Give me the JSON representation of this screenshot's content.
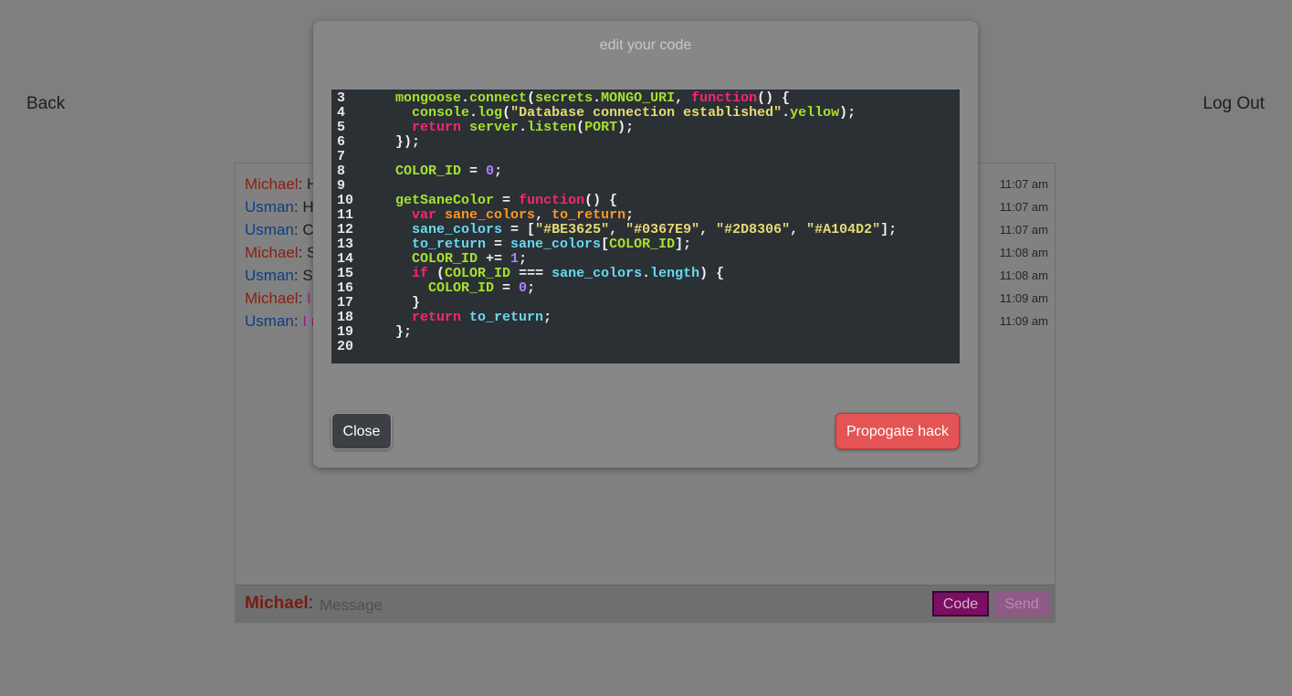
{
  "nav": {
    "back_label": "Back",
    "logout_label": "Log Out"
  },
  "colors": {
    "michael": "#8b1e12",
    "usman": "#0b3f86",
    "magenta_text": "#9a1e87"
  },
  "messages": [
    {
      "sender": "Michael",
      "text": "He",
      "time": "11:07 am",
      "magenta": false
    },
    {
      "sender": "Usman",
      "text": "Hey",
      "time": "11:07 am",
      "magenta": false
    },
    {
      "sender": "Usman",
      "text": "Can",
      "time": "11:07 am",
      "magenta": false
    },
    {
      "sender": "Michael",
      "text": "Su",
      "time": "11:08 am",
      "magenta": false
    },
    {
      "sender": "Usman",
      "text": "Sure",
      "time": "11:08 am",
      "magenta": false
    },
    {
      "sender": "Michael",
      "text": "I m",
      "time": "11:09 am",
      "magenta": true
    },
    {
      "sender": "Usman",
      "text": "I mo",
      "time": "11:09 am",
      "magenta": true
    }
  ],
  "composer": {
    "user": "Michael",
    "placeholder": "Message",
    "code_label": "Code",
    "send_label": "Send"
  },
  "modal": {
    "title": "edit your code",
    "close_label": "Close",
    "propagate_label": "Propogate hack",
    "code_lines": [
      {
        "n": "3",
        "tokens": [
          [
            "  ",
            "w"
          ],
          [
            "mongoose",
            "g"
          ],
          [
            ".",
            "w"
          ],
          [
            "connect",
            "g"
          ],
          [
            "(",
            "w"
          ],
          [
            "secrets",
            "g"
          ],
          [
            ".",
            "w"
          ],
          [
            "MONGO_URI",
            "g"
          ],
          [
            ", ",
            "w"
          ],
          [
            "function",
            "p"
          ],
          [
            "() {",
            "w"
          ]
        ]
      },
      {
        "n": "4",
        "tokens": [
          [
            "    ",
            "w"
          ],
          [
            "console",
            "g"
          ],
          [
            ".",
            "w"
          ],
          [
            "log",
            "g"
          ],
          [
            "(",
            "w"
          ],
          [
            "\"Database connection established\"",
            "y"
          ],
          [
            ".",
            "w"
          ],
          [
            "yellow",
            "g"
          ],
          [
            ");",
            "w"
          ]
        ]
      },
      {
        "n": "5",
        "tokens": [
          [
            "    ",
            "w"
          ],
          [
            "return",
            "p"
          ],
          [
            " ",
            "w"
          ],
          [
            "server",
            "g"
          ],
          [
            ".",
            "w"
          ],
          [
            "listen",
            "g"
          ],
          [
            "(",
            "w"
          ],
          [
            "PORT",
            "g"
          ],
          [
            ");",
            "w"
          ]
        ]
      },
      {
        "n": "6",
        "tokens": [
          [
            "  });",
            "w"
          ]
        ]
      },
      {
        "n": "7",
        "tokens": []
      },
      {
        "n": "8",
        "tokens": [
          [
            "  ",
            "w"
          ],
          [
            "COLOR_ID",
            "g"
          ],
          [
            " = ",
            "w"
          ],
          [
            "0",
            "v"
          ],
          [
            ";",
            "w"
          ]
        ]
      },
      {
        "n": "9",
        "tokens": []
      },
      {
        "n": "10",
        "tokens": [
          [
            "  ",
            "w"
          ],
          [
            "getSaneColor",
            "g"
          ],
          [
            " = ",
            "w"
          ],
          [
            "function",
            "p"
          ],
          [
            "() {",
            "w"
          ]
        ]
      },
      {
        "n": "11",
        "tokens": [
          [
            "    ",
            "w"
          ],
          [
            "var",
            "p"
          ],
          [
            " ",
            "w"
          ],
          [
            "sane_colors",
            "o"
          ],
          [
            ", ",
            "w"
          ],
          [
            "to_return",
            "o"
          ],
          [
            ";",
            "w"
          ]
        ]
      },
      {
        "n": "12",
        "tokens": [
          [
            "    ",
            "w"
          ],
          [
            "sane_colors",
            "c"
          ],
          [
            " = [",
            "w"
          ],
          [
            "\"#BE3625\"",
            "y"
          ],
          [
            ", ",
            "w"
          ],
          [
            "\"#0367E9\"",
            "y"
          ],
          [
            ", ",
            "w"
          ],
          [
            "\"#2D8306\"",
            "y"
          ],
          [
            ", ",
            "w"
          ],
          [
            "\"#A104D2\"",
            "y"
          ],
          [
            "];",
            "w"
          ]
        ]
      },
      {
        "n": "13",
        "tokens": [
          [
            "    ",
            "w"
          ],
          [
            "to_return",
            "c"
          ],
          [
            " = ",
            "w"
          ],
          [
            "sane_colors",
            "c"
          ],
          [
            "[",
            "w"
          ],
          [
            "COLOR_ID",
            "g"
          ],
          [
            "];",
            "w"
          ]
        ]
      },
      {
        "n": "14",
        "tokens": [
          [
            "    ",
            "w"
          ],
          [
            "COLOR_ID",
            "g"
          ],
          [
            " += ",
            "w"
          ],
          [
            "1",
            "v"
          ],
          [
            ";",
            "w"
          ]
        ]
      },
      {
        "n": "15",
        "tokens": [
          [
            "    ",
            "w"
          ],
          [
            "if",
            "p"
          ],
          [
            " (",
            "w"
          ],
          [
            "COLOR_ID",
            "g"
          ],
          [
            " === ",
            "w"
          ],
          [
            "sane_colors",
            "c"
          ],
          [
            ".",
            "w"
          ],
          [
            "length",
            "c"
          ],
          [
            ") {",
            "w"
          ]
        ]
      },
      {
        "n": "16",
        "tokens": [
          [
            "      ",
            "w"
          ],
          [
            "COLOR_ID",
            "g"
          ],
          [
            " = ",
            "w"
          ],
          [
            "0",
            "v"
          ],
          [
            ";",
            "w"
          ]
        ]
      },
      {
        "n": "17",
        "tokens": [
          [
            "    }",
            "w"
          ]
        ]
      },
      {
        "n": "18",
        "tokens": [
          [
            "    ",
            "w"
          ],
          [
            "return",
            "p"
          ],
          [
            " ",
            "w"
          ],
          [
            "to_return",
            "c"
          ],
          [
            ";",
            "w"
          ]
        ]
      },
      {
        "n": "19",
        "tokens": [
          [
            "  };",
            "w"
          ]
        ]
      },
      {
        "n": "20",
        "tokens": []
      }
    ]
  }
}
